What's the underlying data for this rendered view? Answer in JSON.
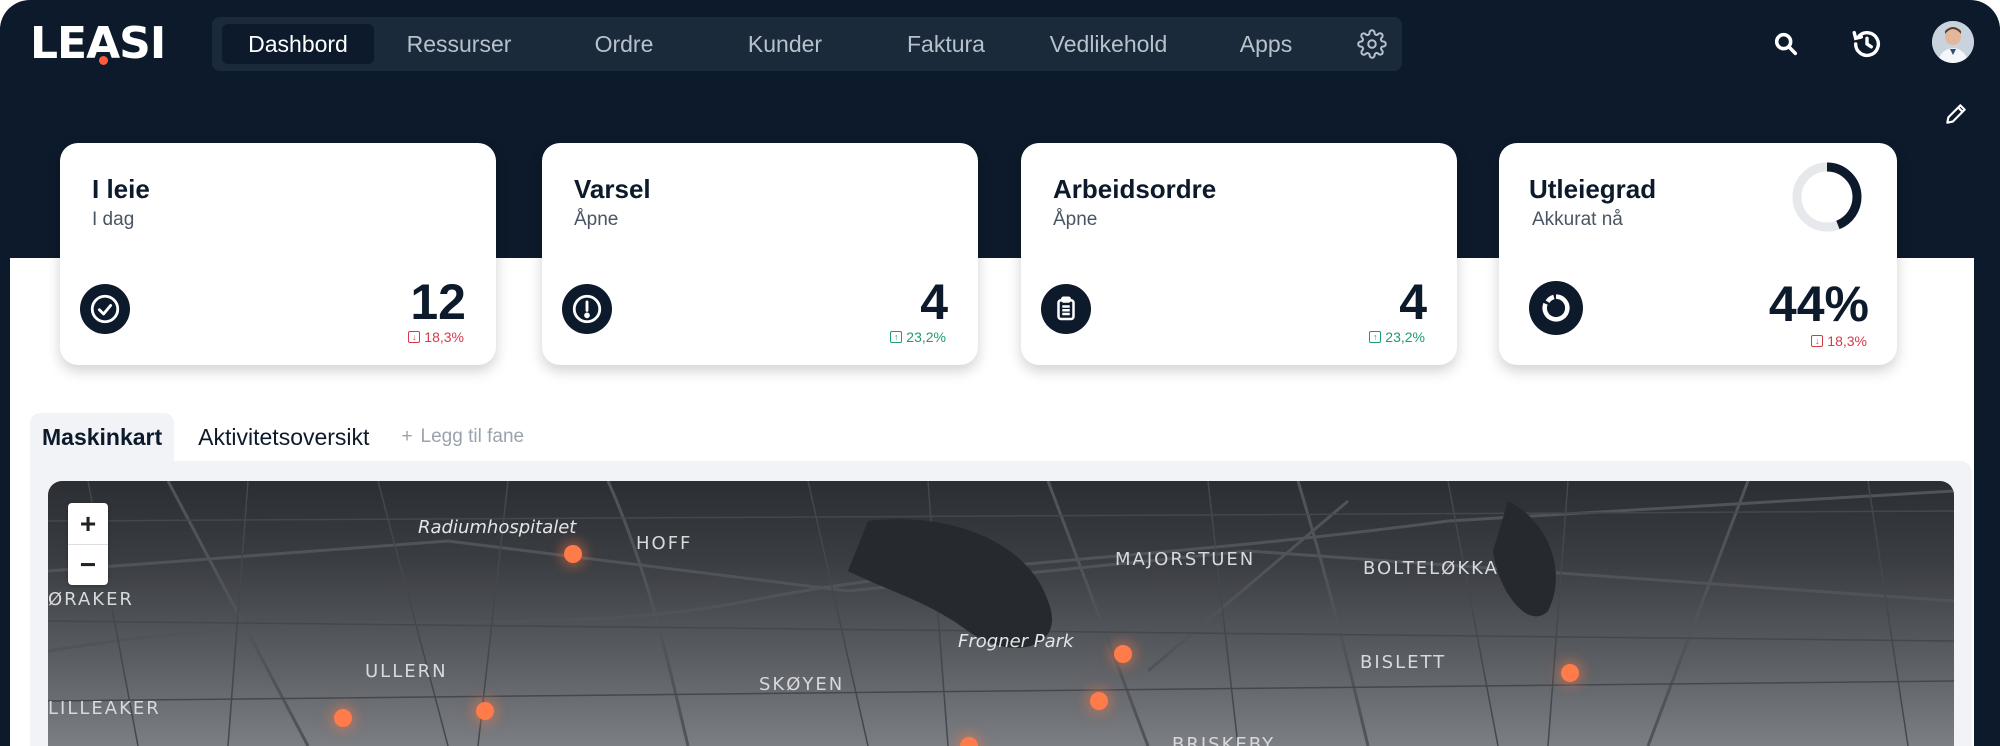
{
  "brand": {
    "logo_pre": "LE",
    "logo_dot": "A",
    "logo_post": "SI"
  },
  "nav": {
    "items": [
      "Dashbord",
      "Ressurser",
      "Ordre",
      "Kunder",
      "Faktura",
      "Vedlikehold",
      "Apps"
    ],
    "active": "Dashbord"
  },
  "icons": {
    "settings": "gear-icon",
    "search": "search-icon",
    "history": "history-icon",
    "edit": "pencil-icon"
  },
  "colors": {
    "navy": "#0c1a2b",
    "accent": "#ff5a3c",
    "negative": "#d43a4a",
    "positive": "#1d9b72",
    "map_pin": "#ff7b49"
  },
  "cards": [
    {
      "title": "I leie",
      "subtitle": "I dag",
      "value": "12",
      "delta": "18,3%",
      "trend": "down",
      "icon": "check-circle-icon"
    },
    {
      "title": "Varsel",
      "subtitle": "Åpne",
      "value": "4",
      "delta": "23,2%",
      "trend": "up",
      "icon": "alert-circle-icon"
    },
    {
      "title": "Arbeidsordre",
      "subtitle": "Åpne",
      "value": "4",
      "delta": "23,2%",
      "trend": "up",
      "icon": "clipboard-icon"
    },
    {
      "title": "Utleiegrad",
      "subtitle": "Akkurat nå",
      "value": "44%",
      "delta": "18,3%",
      "trend": "down",
      "icon": "progress-circle-icon",
      "donut_fraction": 0.44
    }
  ],
  "tabs": {
    "items": [
      "Maskinkart",
      "Aktivitetsoversikt"
    ],
    "active": "Maskinkart",
    "add_label": "Legg til fane"
  },
  "map": {
    "zoom_in": "+",
    "zoom_out": "−",
    "labels": [
      "Radiumhospitalet",
      "HOFF",
      "MAJORSTUEN",
      "BOLTELØKKA",
      "ØRAKER",
      "Frogner Park",
      "BISLETT",
      "ULLERN",
      "SKØYEN",
      "LILLEAKER",
      "BRISKEBY"
    ]
  }
}
